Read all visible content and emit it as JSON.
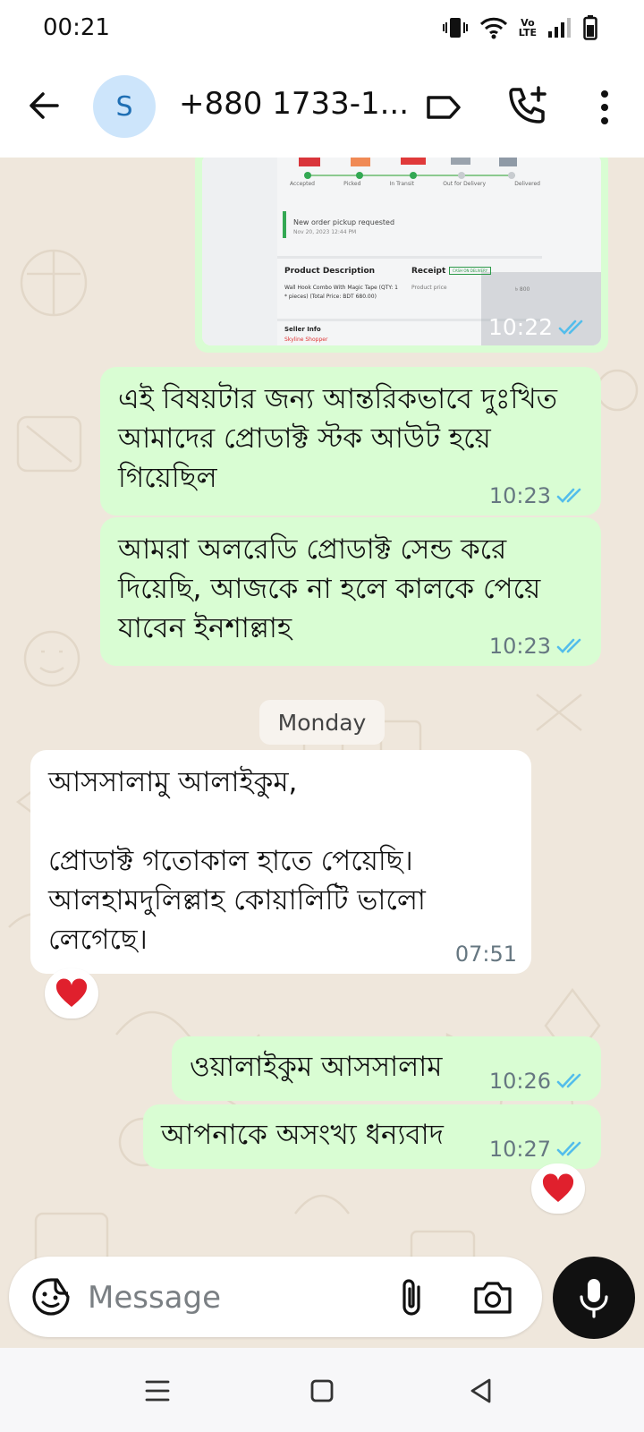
{
  "status_bar": {
    "time": "00:21",
    "volte_line1": "Vo",
    "volte_line2": "LTE"
  },
  "header": {
    "avatar_letter": "S",
    "contact_name": "+880 1733-1..."
  },
  "image_message": {
    "time": "10:22",
    "steps": [
      "Accepted",
      "Picked",
      "In Transit",
      "Out for Delivery",
      "Delivered"
    ],
    "note_title": "New order pickup requested",
    "note_time": "Nov 20, 2023 12:44 PM",
    "product_heading": "Product Description",
    "receipt_heading": "Receipt",
    "receipt_badge": "CASH ON DELIVERY",
    "product_line1": "Wall Hook Combo With Magic Tape (QTY: 1",
    "product_line2": "* pieces) (Total Price: BDT 680.00)",
    "price_label": "Product price",
    "price_value": "৳ 800",
    "seller_heading": "Seller Info",
    "seller_name": "Skyline Shopper"
  },
  "messages": [
    {
      "text": "এই বিষয়টার জন্য আন্তরিকভাবে দুঃখিত আমাদের প্রোডাক্ট স্টক আউট হয়ে গিয়েছিল",
      "time": "10:23"
    },
    {
      "text": "আমরা অলরেডি প্রোডাক্ট সেন্ড করে দিয়েছি, আজকে না হলে কালকে পেয়ে যাবেন ইনশাল্লাহ",
      "time": "10:23"
    },
    {
      "line1": "আসসালামু আলাইকুম,",
      "line2": "প্রোডাক্ট গতোকাল হাতে পেয়েছি। আলহামদুলিল্লাহ কোয়ালিটি ভালো লেগেছে।",
      "time": "07:51"
    },
    {
      "text": "ওয়ালাইকুম আসসালাম",
      "time": "10:26"
    },
    {
      "text": "আপনাকে অসংখ্য ধন্যবাদ",
      "time": "10:27"
    }
  ],
  "date_divider": "Monday",
  "composer": {
    "placeholder": "Message"
  },
  "colors": {
    "outgoing": "#d9fdd3",
    "incoming": "#ffffff",
    "read_tick": "#53bdeb",
    "reaction": "#e0202d"
  }
}
